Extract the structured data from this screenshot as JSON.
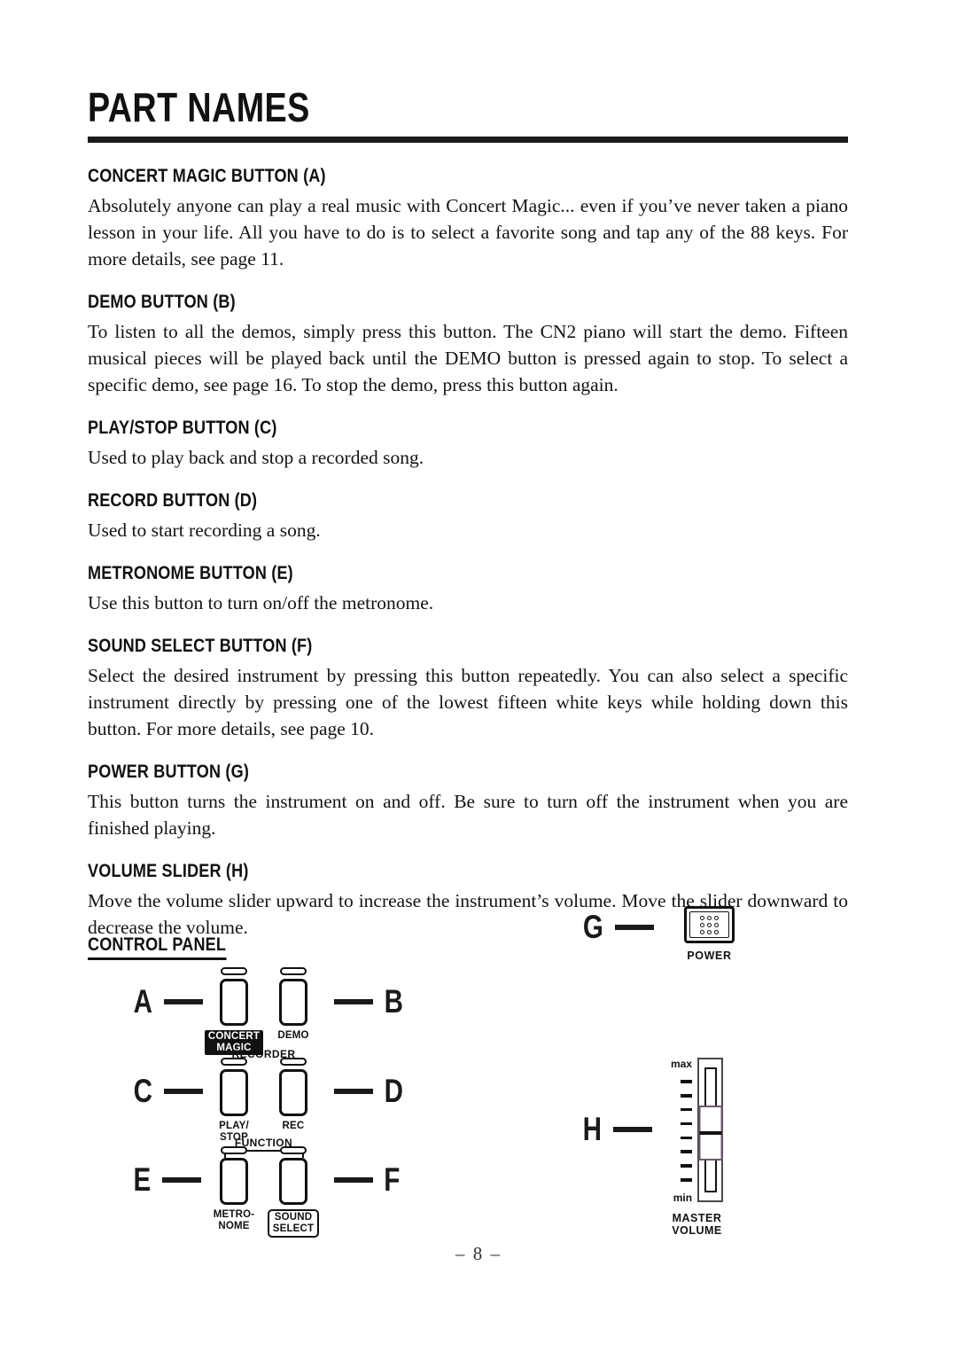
{
  "document": {
    "title": "PART NAMES",
    "page_number": "– 8 –"
  },
  "sections": [
    {
      "heading": "CONCERT MAGIC BUTTON (A)",
      "body": "Absolutely anyone can play a real music with Concert Magic... even if you’ve never taken a piano lesson in your life.  All you have to do is to select a favorite song and tap any of the 88 keys.  For more details, see page 11."
    },
    {
      "heading": "DEMO BUTTON (B)",
      "body": "To listen to all the demos, simply press this button.  The CN2 piano will start the demo.  Fifteen musical pieces will be played back until the DEMO button is pressed again to stop.  To select a specific demo, see page 16.  To stop the demo, press this button again."
    },
    {
      "heading": "PLAY/STOP BUTTON (C)",
      "body": "Used to play back and stop a recorded song."
    },
    {
      "heading": "RECORD BUTTON (D)",
      "body": "Used to start recording a song."
    },
    {
      "heading": "METRONOME BUTTON (E)",
      "body": "Use this button to turn on/off the metronome."
    },
    {
      "heading": "SOUND SELECT BUTTON (F)",
      "body": "Select the desired instrument by pressing this button repeatedly.  You can also select a specific instrument directly by pressing one of the lowest fifteen white keys while holding down this button.  For more details, see page 10."
    },
    {
      "heading": "POWER BUTTON (G)",
      "body": "This button turns the instrument on and off.  Be sure to turn off the instrument when you are finished playing."
    },
    {
      "heading": "VOLUME SLIDER (H)",
      "body": "Move the volume slider upward to increase the instrument’s volume.  Move the slider downward to decrease the volume."
    }
  ],
  "control_panel": {
    "heading": "CONTROL PANEL",
    "callouts": {
      "a": "A",
      "b": "B",
      "c": "C",
      "d": "D",
      "e": "E",
      "f": "F",
      "g": "G",
      "h": "H"
    },
    "group_labels": {
      "recorder": "RECORDER",
      "function": "FUNCTION"
    },
    "buttons": {
      "concert_magic": "CONCERT\nMAGIC",
      "demo": "DEMO",
      "play_stop": "PLAY/\nSTOP",
      "rec": "REC",
      "metronome": "METRO-\nNOME",
      "sound_select": "SOUND\nSELECT"
    },
    "power": {
      "label": "POWER"
    },
    "volume": {
      "max_label": "max",
      "min_label": "min",
      "caption": "MASTER\nVOLUME",
      "tick_count": 8
    }
  },
  "colors": {
    "ink": "#1a1a1a",
    "paper": "#ffffff"
  }
}
